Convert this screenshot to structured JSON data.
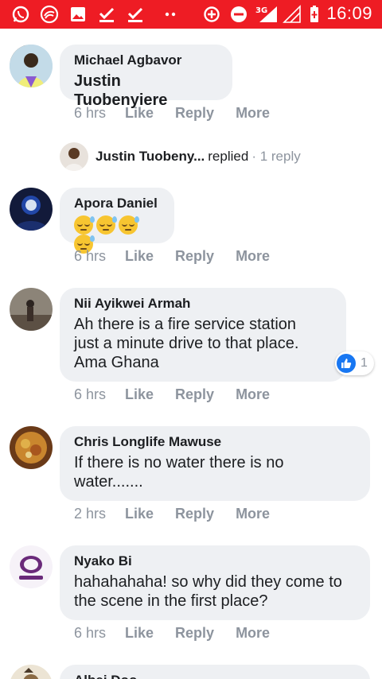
{
  "status_bar": {
    "time": "16:09",
    "network": "3G",
    "colors": {
      "background": "#ee1c24"
    }
  },
  "comments": [
    {
      "author": "Michael Agbavor",
      "text": "Justin Tuobenyiere",
      "text_bold": true,
      "time": "6 hrs",
      "actions": [
        "Like",
        "Reply",
        "More"
      ]
    },
    {
      "author": "Apora Daniel",
      "emoji_count": 4,
      "time": "6 hrs",
      "actions": [
        "Like",
        "Reply",
        "More"
      ]
    },
    {
      "author": "Nii Ayikwei Armah",
      "lines": [
        "Ah there is a fire service station",
        "just a minute drive to that place.",
        "Ama Ghana"
      ],
      "time": "6 hrs",
      "actions": [
        "Like",
        "Reply",
        "More"
      ],
      "reactions": {
        "count": "1"
      }
    },
    {
      "author": "Chris Longlife Mawuse",
      "lines": [
        "If there is no water there is no",
        "water......."
      ],
      "time": "2 hrs",
      "actions": [
        "Like",
        "Reply",
        "More"
      ]
    },
    {
      "author": "Nyako Bi",
      "lines": [
        "hahahahaha! so why did they come to",
        "the scene in the first place?"
      ],
      "time": "6 hrs",
      "actions": [
        "Like",
        "Reply",
        "More"
      ]
    },
    {
      "author": "Albei Doo"
    }
  ],
  "replies_summary": {
    "name": "Justin Tuobeny...",
    "replied": "replied",
    "count": "· 1 reply"
  },
  "accent_color": "#1877f2"
}
